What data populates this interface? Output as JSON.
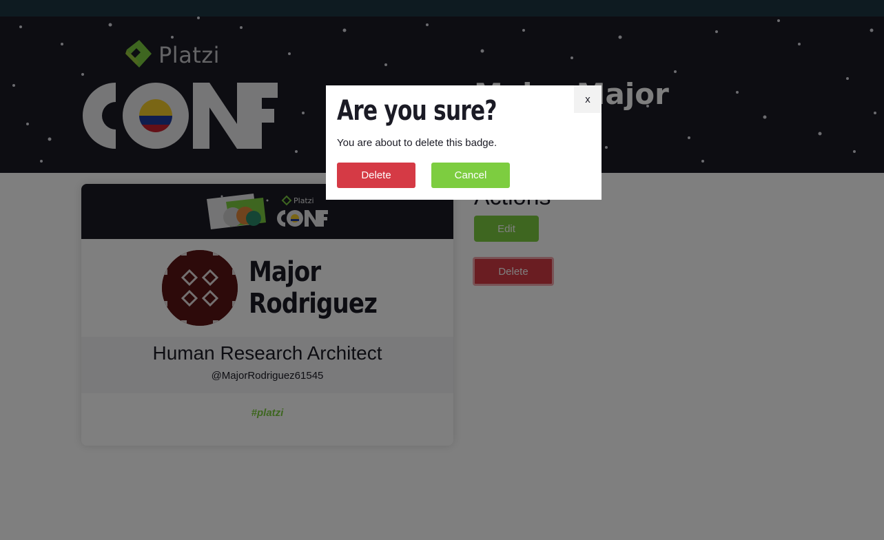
{
  "hero": {
    "brand": "Platzi",
    "name": "Major Major"
  },
  "badge": {
    "first_name": "Major",
    "last_name": "Rodriguez",
    "job_title": "Human Research Architect",
    "twitter": "@MajorRodriguez61545",
    "hashtag": "#platzi",
    "header_brand": "Platzi"
  },
  "actions": {
    "title": "Actions",
    "edit_label": "Edit",
    "delete_label": "Delete"
  },
  "modal": {
    "title": "Are you sure?",
    "message": "You are about to delete this badge.",
    "close_label": "x",
    "delete_label": "Delete",
    "cancel_label": "Cancel"
  },
  "colors": {
    "brand_green": "#7dcd40",
    "danger_red": "#d53a45",
    "dark_navy": "#1b1b25",
    "topbar": "#1c3643"
  }
}
